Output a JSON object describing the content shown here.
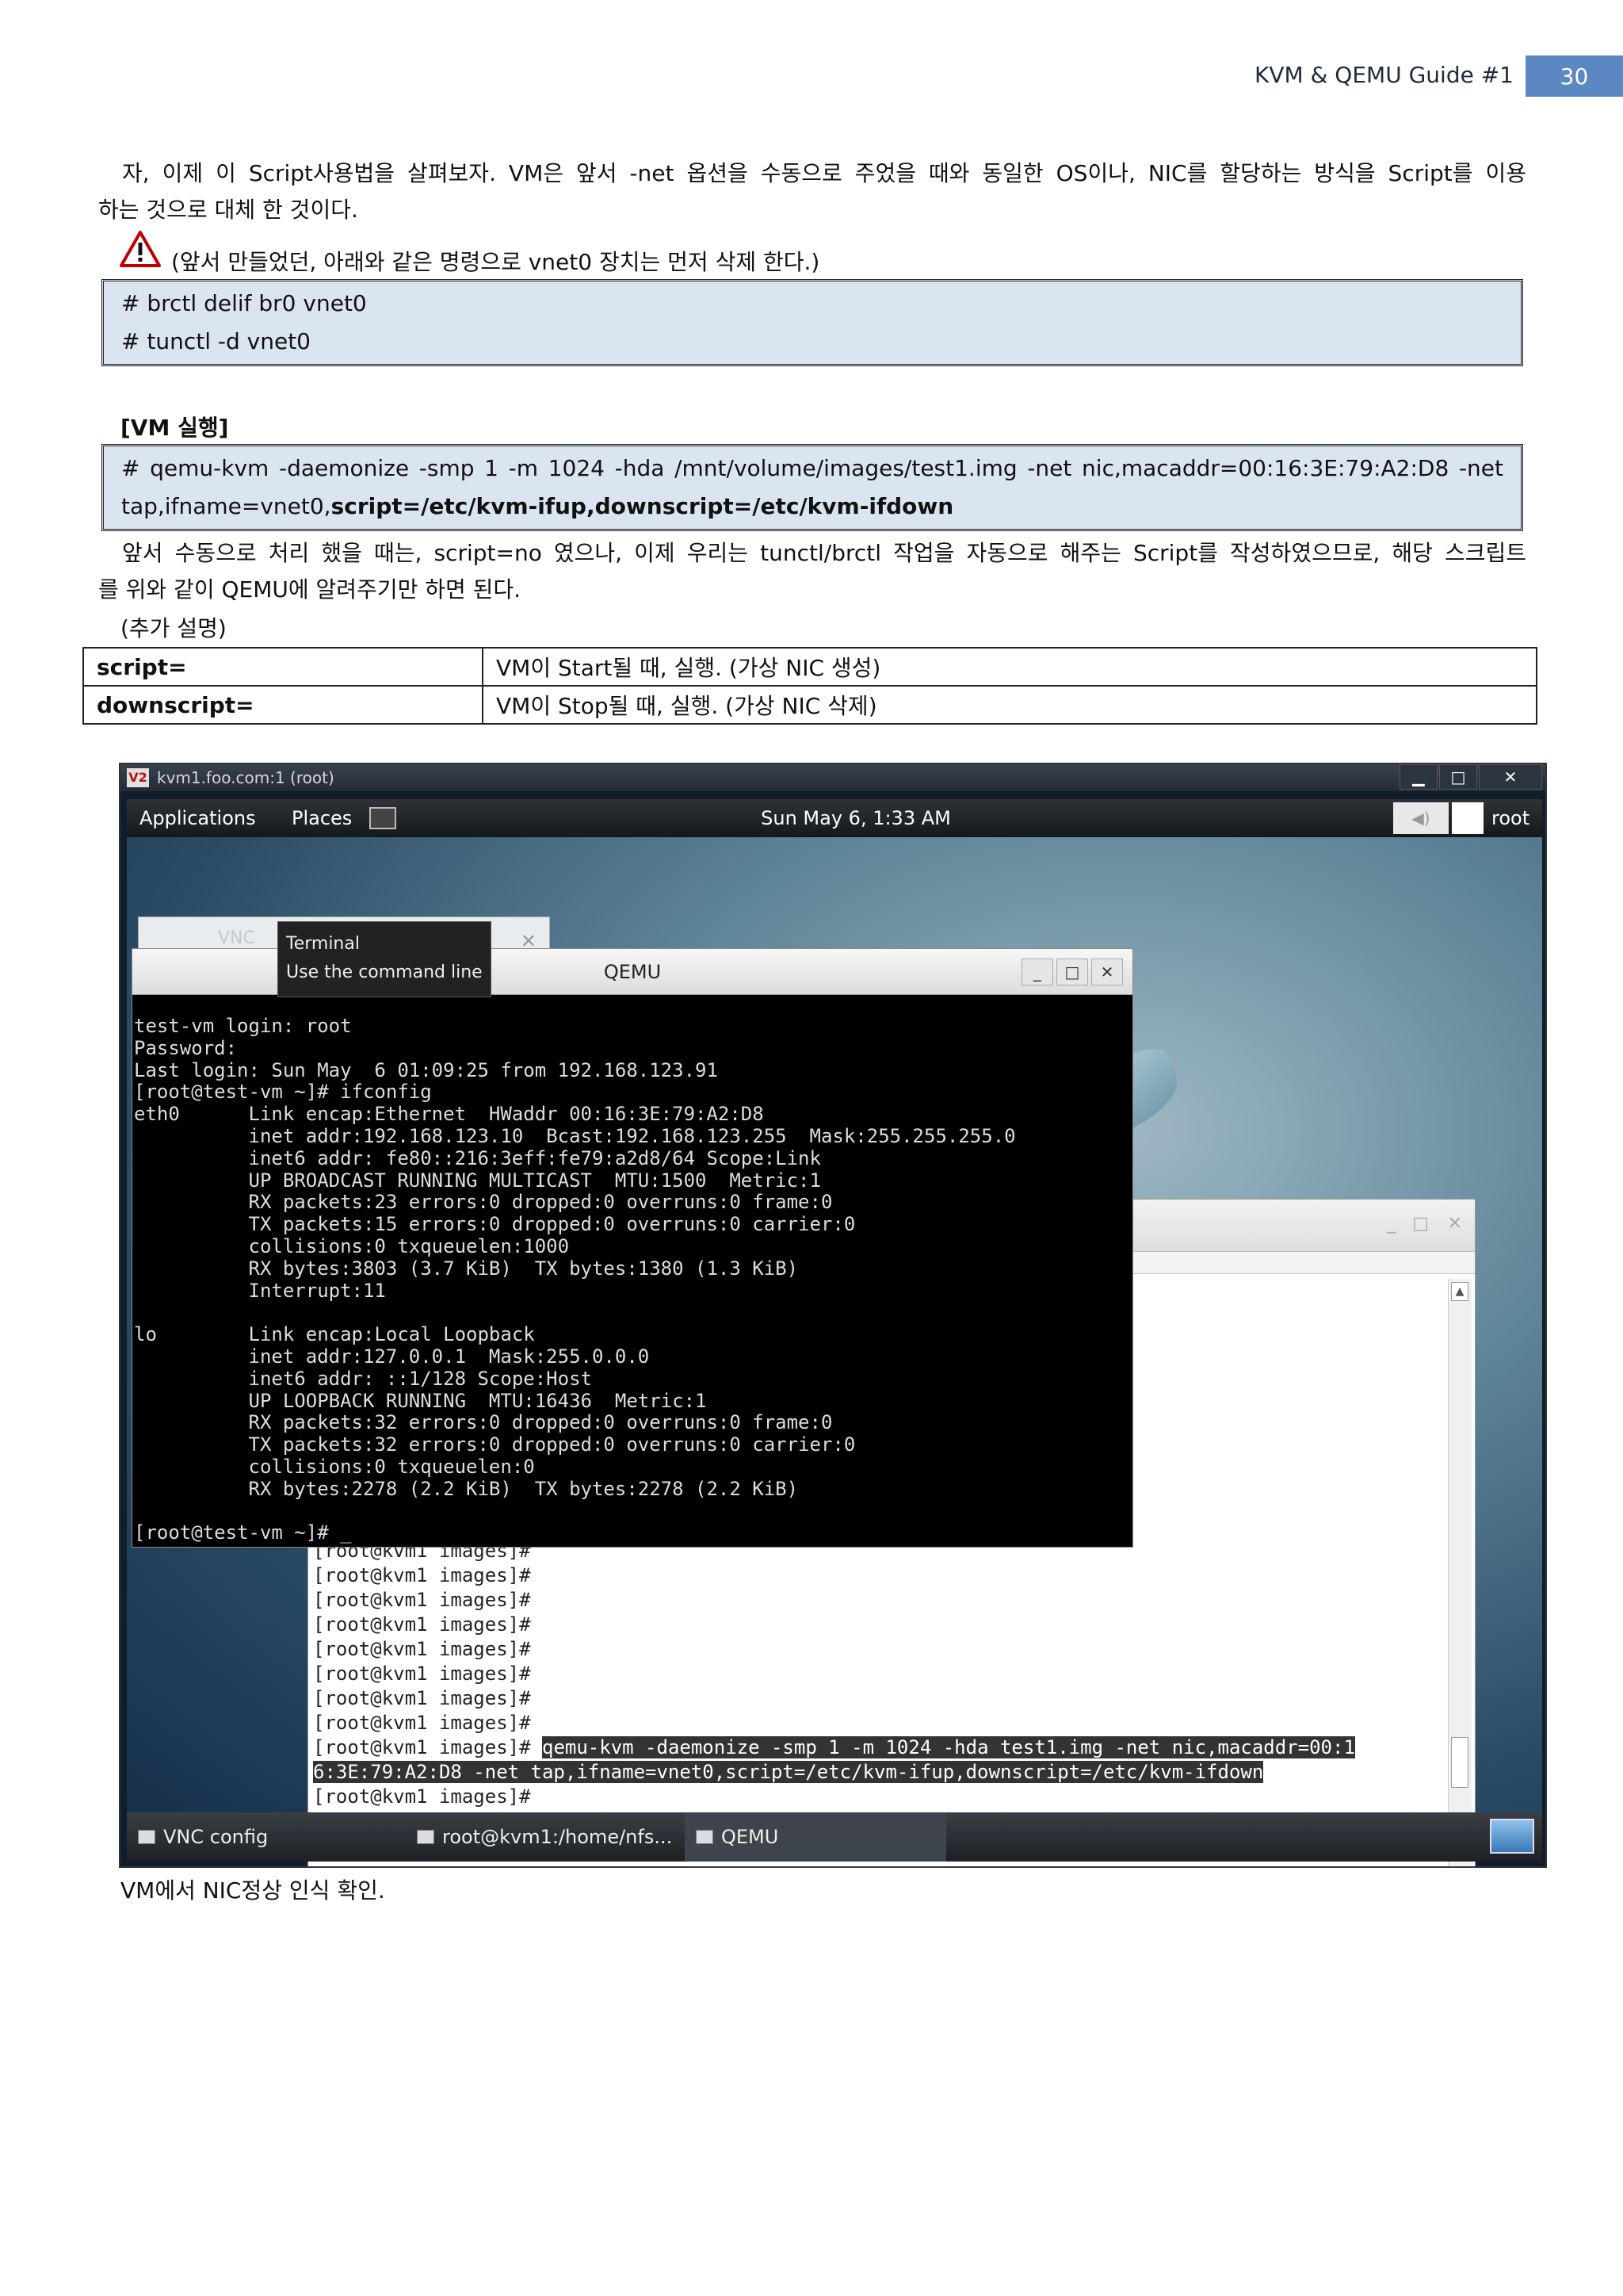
{
  "header": {
    "title": "KVM & QEMU Guide #1",
    "page": "30"
  },
  "intro": {
    "line1": "자, 이제 이 Script사용법을 살펴보자. VM은 앞서 -net 옵션을 수동으로 주었을 때와 동일한 OS이나, NIC를 할당하는 방식을 Script를 이용",
    "line2": "하는 것으로 대체 한 것이다."
  },
  "warning_note": "(앞서 만들었던, 아래와 같은 명령으로 vnet0 장치는 먼저 삭제 한다.)",
  "code1": [
    "# brctl delif br0 vnet0",
    "# tunctl -d vnet0"
  ],
  "vm_heading": "[VM 실행]",
  "code2": {
    "line1": "# qemu-kvm -daemonize -smp 1 -m 1024 -hda /mnt/volume/images/test1.img -net nic,macaddr=00:16:3E:79:A2:D8 -net",
    "line2_plain": "tap,ifname=vnet0,",
    "line2_bold": "script=/etc/kvm-ifup,downscript=/etc/kvm-ifdown"
  },
  "para2": {
    "line1": "앞서 수동으로 처리 했을 때는, script=no 였으나, 이제 우리는 tunctl/brctl 작업을 자동으로 해주는 Script를 작성하였으므로, 해당 스크립트",
    "line2": "를 위와 같이 QEMU에 알려주기만 하면 된다."
  },
  "extra_label": "(추가 설명)",
  "options": [
    {
      "key": "script=",
      "desc": "VM이 Start될 때, 실행. (가상 NIC 생성)"
    },
    {
      "key": "downscript=",
      "desc": "VM이 Stop될 때, 실행. (가상 NIC 삭제)"
    }
  ],
  "screenshot": {
    "window_title": "kvm1.foo.com:1 (root)",
    "vnc_logo": "V2",
    "panel": {
      "applications": "Applications",
      "places": "Places",
      "clock": "Sun May  6,  1:33 AM",
      "user": "root"
    },
    "vnc_tab": "VNC",
    "tooltip": [
      "Terminal",
      "Use the command line"
    ],
    "qemu_title": "QEMU",
    "qemu_lines": [
      "test-vm login: root",
      "Password:",
      "Last login: Sun May  6 01:09:25 from 192.168.123.91",
      "[root@test-vm ~]# ifconfig",
      "eth0      Link encap:Ethernet  HWaddr 00:16:3E:79:A2:D8",
      "          inet addr:192.168.123.10  Bcast:192.168.123.255  Mask:255.255.255.0",
      "          inet6 addr: fe80::216:3eff:fe79:a2d8/64 Scope:Link",
      "          UP BROADCAST RUNNING MULTICAST  MTU:1500  Metric:1",
      "          RX packets:23 errors:0 dropped:0 overruns:0 frame:0",
      "          TX packets:15 errors:0 dropped:0 overruns:0 carrier:0",
      "          collisions:0 txqueuelen:1000",
      "          RX bytes:3803 (3.7 KiB)  TX bytes:1380 (1.3 KiB)",
      "          Interrupt:11",
      "",
      "lo        Link encap:Local Loopback",
      "          inet addr:127.0.0.1  Mask:255.0.0.0",
      "          inet6 addr: ::1/128 Scope:Host",
      "          UP LOOPBACK RUNNING  MTU:16436  Metric:1",
      "          RX packets:32 errors:0 dropped:0 overruns:0 frame:0",
      "          TX packets:32 errors:0 dropped:0 overruns:0 carrier:0",
      "          collisions:0 txqueuelen:0",
      "          RX bytes:2278 (2.2 KiB)  TX bytes:2278 (2.2 KiB)",
      "",
      "[root@test-vm ~]# _"
    ],
    "back_prompt": "[root@kvm1 images]#",
    "back_cmd_line1": "qemu-kvm -daemonize -smp 1 -m 1024 -hda test1.img -net nic,macaddr=00:1",
    "back_cmd_line2": "6:3E:79:A2:D8 -net tap,ifname=vnet0,script=/etc/kvm-ifup,downscript=/etc/kvm-ifdown",
    "taskbar": [
      "VNC config",
      "root@kvm1:/home/nfs...",
      "QEMU"
    ]
  },
  "caption": "VM에서 NIC정상 인식 확인."
}
